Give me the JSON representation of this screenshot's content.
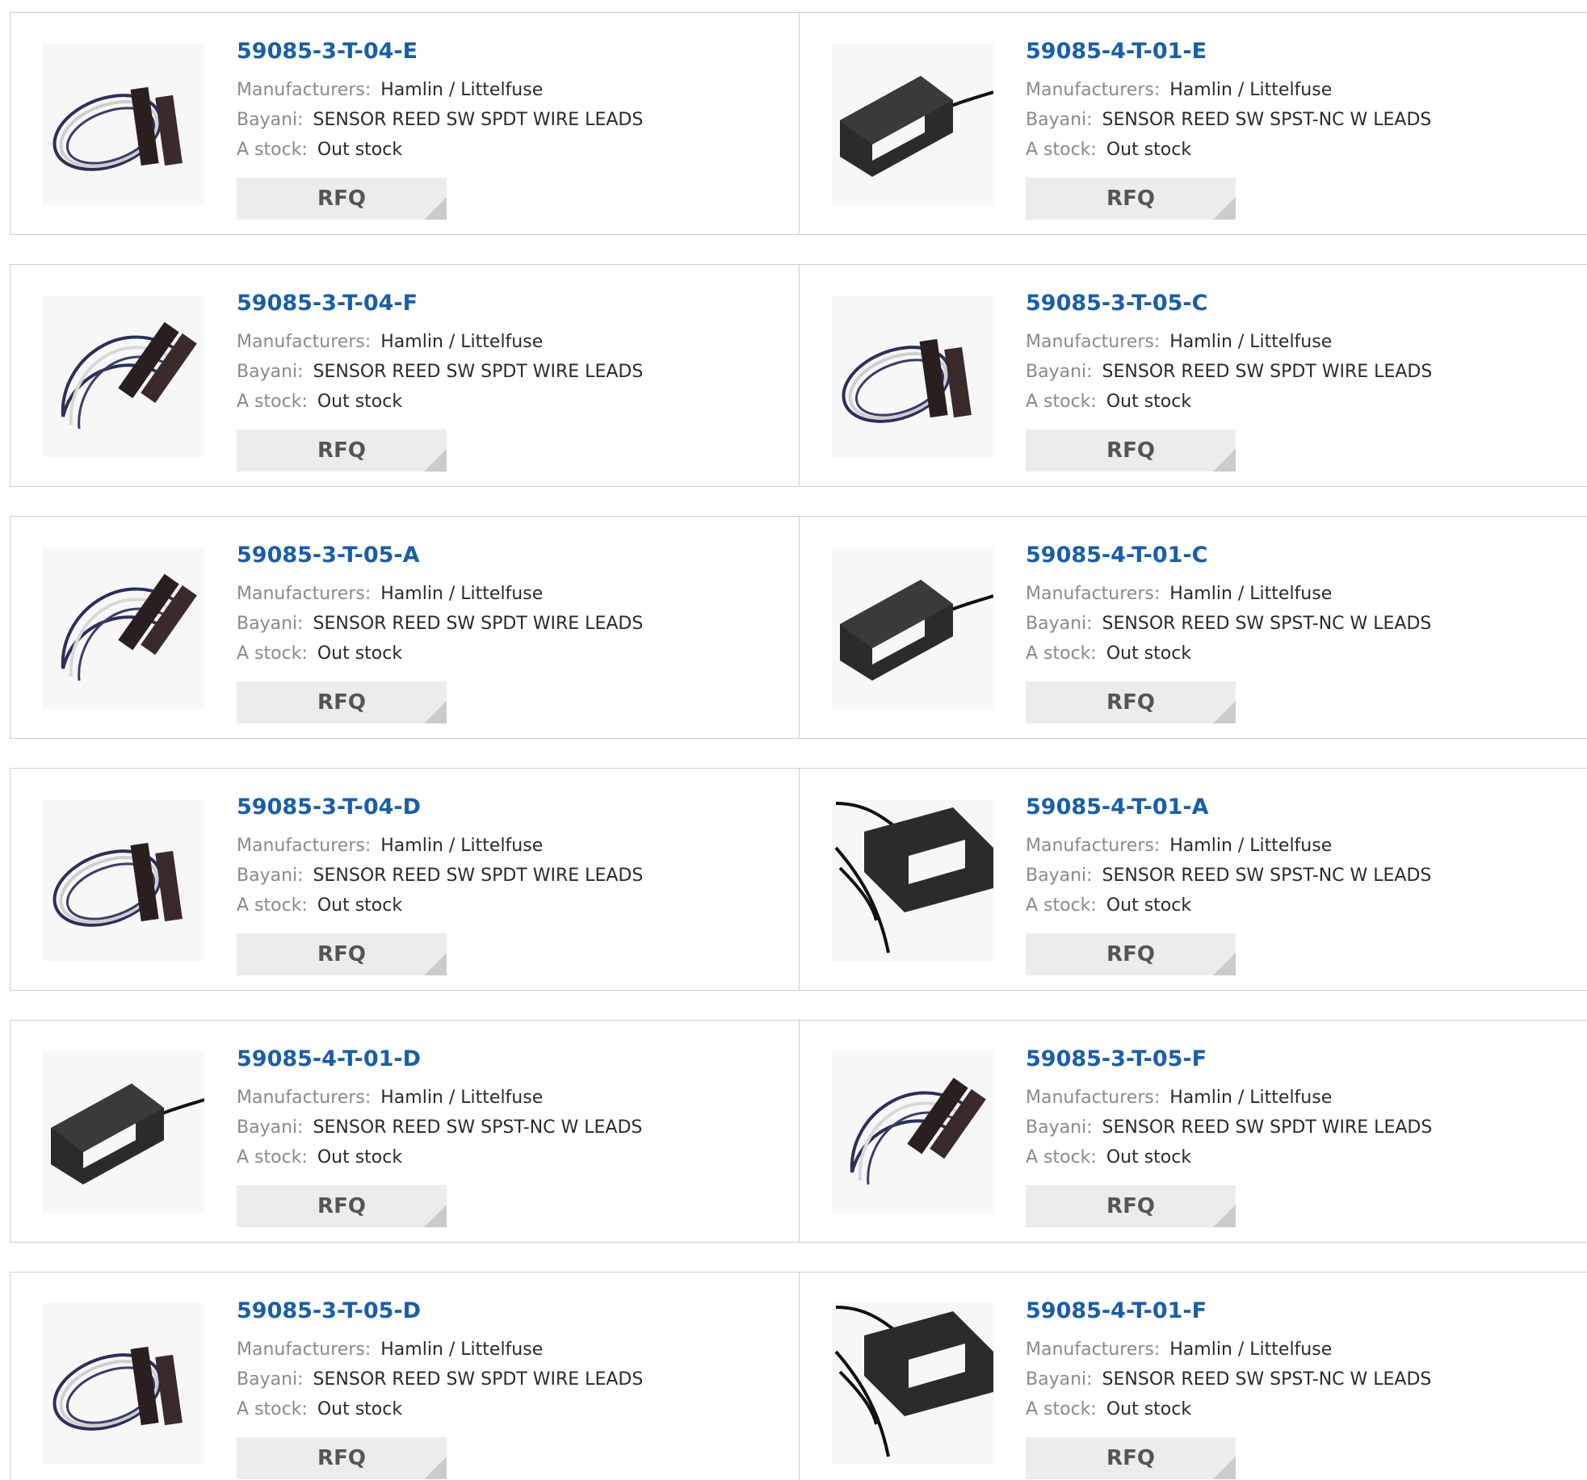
{
  "labels": {
    "manufacturers": "Manufacturers:",
    "description": "Bayani:",
    "stock": "A stock:",
    "rfq": "RFQ"
  },
  "products": [
    {
      "part_number": "59085-3-T-04-E",
      "manufacturer": "Hamlin / Littelfuse",
      "description": "SENSOR REED SW SPDT WIRE LEADS",
      "stock": "Out stock",
      "image_icon": "reed-sensor-coil-icon"
    },
    {
      "part_number": "59085-4-T-01-E",
      "manufacturer": "Hamlin / Littelfuse",
      "description": "SENSOR REED SW SPST-NC W LEADS",
      "stock": "Out stock",
      "image_icon": "reed-sensor-block-icon"
    },
    {
      "part_number": "59085-3-T-04-F",
      "manufacturer": "Hamlin / Littelfuse",
      "description": "SENSOR REED SW SPDT WIRE LEADS",
      "stock": "Out stock",
      "image_icon": "reed-sensor-loop-icon"
    },
    {
      "part_number": "59085-3-T-05-C",
      "manufacturer": "Hamlin / Littelfuse",
      "description": "SENSOR REED SW SPDT WIRE LEADS",
      "stock": "Out stock",
      "image_icon": "reed-sensor-coil-icon"
    },
    {
      "part_number": "59085-3-T-05-A",
      "manufacturer": "Hamlin / Littelfuse",
      "description": "SENSOR REED SW SPDT WIRE LEADS",
      "stock": "Out stock",
      "image_icon": "reed-sensor-loop-icon"
    },
    {
      "part_number": "59085-4-T-01-C",
      "manufacturer": "Hamlin / Littelfuse",
      "description": "SENSOR REED SW SPST-NC W LEADS",
      "stock": "Out stock",
      "image_icon": "reed-sensor-block-icon"
    },
    {
      "part_number": "59085-3-T-04-D",
      "manufacturer": "Hamlin / Littelfuse",
      "description": "SENSOR REED SW SPDT WIRE LEADS",
      "stock": "Out stock",
      "image_icon": "reed-sensor-coil-icon"
    },
    {
      "part_number": "59085-4-T-01-A",
      "manufacturer": "Hamlin / Littelfuse",
      "description": "SENSOR REED SW SPST-NC W LEADS",
      "stock": "Out stock",
      "image_icon": "reed-sensor-wires-icon"
    },
    {
      "part_number": "59085-4-T-01-D",
      "manufacturer": "Hamlin / Littelfuse",
      "description": "SENSOR REED SW SPST-NC W LEADS",
      "stock": "Out stock",
      "image_icon": "reed-sensor-block-icon"
    },
    {
      "part_number": "59085-3-T-05-F",
      "manufacturer": "Hamlin / Littelfuse",
      "description": "SENSOR REED SW SPDT WIRE LEADS",
      "stock": "Out stock",
      "image_icon": "reed-sensor-loop-icon"
    },
    {
      "part_number": "59085-3-T-05-D",
      "manufacturer": "Hamlin / Littelfuse",
      "description": "SENSOR REED SW SPDT WIRE LEADS",
      "stock": "Out stock",
      "image_icon": "reed-sensor-coil-icon"
    },
    {
      "part_number": "59085-4-T-01-F",
      "manufacturer": "Hamlin / Littelfuse",
      "description": "SENSOR REED SW SPST-NC W LEADS",
      "stock": "Out stock",
      "image_icon": "reed-sensor-wires-icon"
    }
  ]
}
